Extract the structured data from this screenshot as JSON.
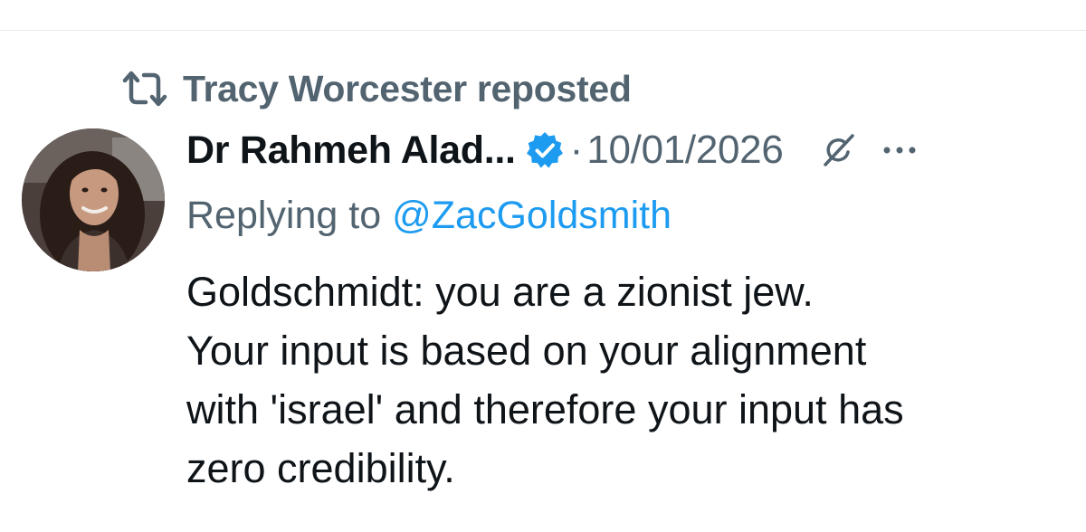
{
  "repost": {
    "icon": "repost-icon",
    "text": "Tracy Worcester reposted"
  },
  "author": {
    "name": "Dr Rahmeh Alad...",
    "verified_icon": "verified-badge-icon",
    "verified_color": "#1d9bf0",
    "avatar": "profile-photo"
  },
  "post": {
    "separator": "·",
    "date": "10/01/2026",
    "reply_prefix": "Replying to",
    "reply_handle": "@ZacGoldsmith",
    "lines": [
      "Goldschmidt: you are a zionist jew.",
      "Your input is based on your alignment",
      "with 'israel' and therefore your input has",
      "zero credibility."
    ]
  },
  "actions": {
    "grok_icon": "grok-icon",
    "more_icon": "more-options-icon"
  },
  "colors": {
    "text_primary": "#0f1419",
    "text_secondary": "#536471",
    "link": "#1d9bf0",
    "divider": "#e6e9ec"
  }
}
